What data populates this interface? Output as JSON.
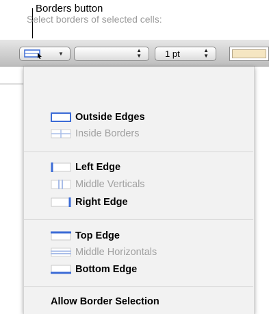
{
  "callout": {
    "text": "Borders button"
  },
  "toolbar": {
    "line_width": "1 pt",
    "color_well": "#f5e6c2"
  },
  "menu": {
    "header": "Select borders of selected cells:",
    "groups": [
      [
        {
          "label": "Outside Edges",
          "enabled": true,
          "icon": "outside-edges-icon"
        },
        {
          "label": "Inside Borders",
          "enabled": false,
          "icon": "inside-borders-icon"
        }
      ],
      [
        {
          "label": "Left Edge",
          "enabled": true,
          "icon": "left-edge-icon"
        },
        {
          "label": "Middle Verticals",
          "enabled": false,
          "icon": "middle-verticals-icon"
        },
        {
          "label": "Right Edge",
          "enabled": true,
          "icon": "right-edge-icon"
        }
      ],
      [
        {
          "label": "Top Edge",
          "enabled": true,
          "icon": "top-edge-icon"
        },
        {
          "label": "Middle Horizontals",
          "enabled": false,
          "icon": "middle-horizontals-icon"
        },
        {
          "label": "Bottom Edge",
          "enabled": true,
          "icon": "bottom-edge-icon"
        }
      ]
    ],
    "footer": "Allow Border Selection"
  },
  "colors": {
    "accent_blue": "#3b6bd6",
    "disabled_blue": "#a9bde8"
  }
}
